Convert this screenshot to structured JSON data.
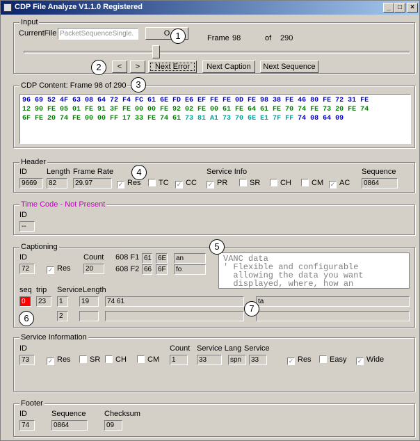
{
  "window": {
    "title": "CDP File Analyze V1.1.0 Registered"
  },
  "input": {
    "group_label": "Input",
    "current_file_label": "CurrentFile",
    "current_file_value": "PacketSequenceSingle.",
    "browse_label": "O",
    "frame_label": "Frame",
    "frame_value": "98",
    "of_label": "of",
    "total_value": "290",
    "prev_label": "<",
    "next_label": ">",
    "next_error_label": "Next Error",
    "next_caption_label": "Next Caption",
    "next_sequence_label": "Next Sequence",
    "slider_position": 0.34
  },
  "cdp_content": {
    "group_label": "CDP Content:",
    "frame_text": "Frame 98 of 290",
    "line1": "96 69 52 4F 63 08 64 72 F4 FC 61 6E FD E6 EF FE FE 0D FE 98 38 FE 46 80 FE 72 31 FE",
    "line2": "12 90 FE 05 01 FE 91 3F FE 00 00 FE 92 02 FE 00 61 FE 64 61 FE 70 74 FE 73 20 FE 74",
    "line3a": "6F FE 20 74 FE 00 00 FF 17 33 FE 74 61 ",
    "line3b": "73 81 A1 73 70 6E E1 7F FF ",
    "line3c": "74 08 64 09"
  },
  "header": {
    "group_label": "Header",
    "id_label": "ID",
    "id_value": "9669",
    "length_label": "Length",
    "length_value": "82",
    "frame_rate_label": "Frame Rate",
    "frame_rate_value": "29.97",
    "res_label": "Res",
    "tc_label": "TC",
    "cc_label": "CC",
    "service_info_label": "Service Info",
    "pr_label": "PR",
    "sr_label": "SR",
    "ch_label": "CH",
    "cm_label": "CM",
    "ac_label": "AC",
    "sequence_label": "Sequence",
    "sequence_value": "0864"
  },
  "time_code": {
    "group_label": "Time Code - Not Present",
    "id_label": "ID",
    "id_value": "--"
  },
  "captioning": {
    "group_label": "Captioning",
    "id_label": "ID",
    "id_value": "72",
    "res_label": "Res",
    "count_label": "Count",
    "count_value": "20",
    "f1_label": "608 F1",
    "f1_a": "61",
    "f1_b": "6E",
    "f1_text": "an",
    "f2_label": "608 F2",
    "f2_a": "66",
    "f2_b": "6F",
    "f2_text": "fo",
    "vanc_text": "VANC data\n' Flexible and configurable\n  allowing the data you want\n  displayed, where, how an",
    "seq_label": "seq",
    "trip_label": "trip",
    "service_label": "Service",
    "length_label": "Length",
    "row1_seq": "0",
    "row1_trip": "23",
    "row1_service": "1",
    "row1_length": "19",
    "row1_data": "74 61",
    "row1_text": "ta",
    "row2_service": "2"
  },
  "service_information": {
    "group_label": "Service Information",
    "id_label": "ID",
    "id_value": "73",
    "res_label": "Res",
    "sr_label": "SR",
    "ch_label": "CH",
    "cm_label": "CM",
    "count_label": "Count",
    "count_value": "1",
    "service_lang_label": "Service Lang",
    "service_lang_value": "33",
    "lang_value": "spn",
    "service_label": "Service",
    "service_value": "33",
    "res2_label": "Res",
    "easy_label": "Easy",
    "wide_label": "Wide"
  },
  "footer": {
    "group_label": "Footer",
    "id_label": "ID",
    "id_value": "74",
    "sequence_label": "Sequence",
    "sequence_value": "0864",
    "checksum_label": "Checksum",
    "checksum_value": "09"
  },
  "callouts": [
    "1",
    "2",
    "3",
    "4",
    "5",
    "6",
    "7"
  ],
  "colors": {
    "titlebar": "#0a246a",
    "face": "#d4d0c8",
    "timecode_label": "#c000c0",
    "seq_highlight": "#ff0000"
  }
}
